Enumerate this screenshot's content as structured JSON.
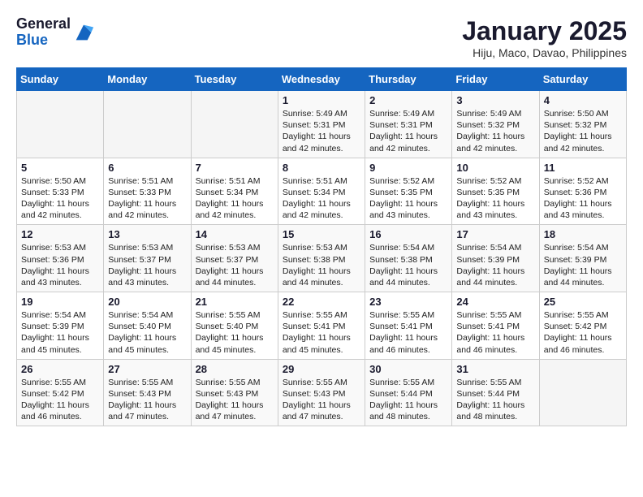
{
  "logo": {
    "general": "General",
    "blue": "Blue"
  },
  "title": "January 2025",
  "subtitle": "Hiju, Maco, Davao, Philippines",
  "days_header": [
    "Sunday",
    "Monday",
    "Tuesday",
    "Wednesday",
    "Thursday",
    "Friday",
    "Saturday"
  ],
  "weeks": [
    [
      {
        "day": "",
        "info": ""
      },
      {
        "day": "",
        "info": ""
      },
      {
        "day": "",
        "info": ""
      },
      {
        "day": "1",
        "info": "Sunrise: 5:49 AM\nSunset: 5:31 PM\nDaylight: 11 hours\nand 42 minutes."
      },
      {
        "day": "2",
        "info": "Sunrise: 5:49 AM\nSunset: 5:31 PM\nDaylight: 11 hours\nand 42 minutes."
      },
      {
        "day": "3",
        "info": "Sunrise: 5:49 AM\nSunset: 5:32 PM\nDaylight: 11 hours\nand 42 minutes."
      },
      {
        "day": "4",
        "info": "Sunrise: 5:50 AM\nSunset: 5:32 PM\nDaylight: 11 hours\nand 42 minutes."
      }
    ],
    [
      {
        "day": "5",
        "info": "Sunrise: 5:50 AM\nSunset: 5:33 PM\nDaylight: 11 hours\nand 42 minutes."
      },
      {
        "day": "6",
        "info": "Sunrise: 5:51 AM\nSunset: 5:33 PM\nDaylight: 11 hours\nand 42 minutes."
      },
      {
        "day": "7",
        "info": "Sunrise: 5:51 AM\nSunset: 5:34 PM\nDaylight: 11 hours\nand 42 minutes."
      },
      {
        "day": "8",
        "info": "Sunrise: 5:51 AM\nSunset: 5:34 PM\nDaylight: 11 hours\nand 42 minutes."
      },
      {
        "day": "9",
        "info": "Sunrise: 5:52 AM\nSunset: 5:35 PM\nDaylight: 11 hours\nand 43 minutes."
      },
      {
        "day": "10",
        "info": "Sunrise: 5:52 AM\nSunset: 5:35 PM\nDaylight: 11 hours\nand 43 minutes."
      },
      {
        "day": "11",
        "info": "Sunrise: 5:52 AM\nSunset: 5:36 PM\nDaylight: 11 hours\nand 43 minutes."
      }
    ],
    [
      {
        "day": "12",
        "info": "Sunrise: 5:53 AM\nSunset: 5:36 PM\nDaylight: 11 hours\nand 43 minutes."
      },
      {
        "day": "13",
        "info": "Sunrise: 5:53 AM\nSunset: 5:37 PM\nDaylight: 11 hours\nand 43 minutes."
      },
      {
        "day": "14",
        "info": "Sunrise: 5:53 AM\nSunset: 5:37 PM\nDaylight: 11 hours\nand 44 minutes."
      },
      {
        "day": "15",
        "info": "Sunrise: 5:53 AM\nSunset: 5:38 PM\nDaylight: 11 hours\nand 44 minutes."
      },
      {
        "day": "16",
        "info": "Sunrise: 5:54 AM\nSunset: 5:38 PM\nDaylight: 11 hours\nand 44 minutes."
      },
      {
        "day": "17",
        "info": "Sunrise: 5:54 AM\nSunset: 5:39 PM\nDaylight: 11 hours\nand 44 minutes."
      },
      {
        "day": "18",
        "info": "Sunrise: 5:54 AM\nSunset: 5:39 PM\nDaylight: 11 hours\nand 44 minutes."
      }
    ],
    [
      {
        "day": "19",
        "info": "Sunrise: 5:54 AM\nSunset: 5:39 PM\nDaylight: 11 hours\nand 45 minutes."
      },
      {
        "day": "20",
        "info": "Sunrise: 5:54 AM\nSunset: 5:40 PM\nDaylight: 11 hours\nand 45 minutes."
      },
      {
        "day": "21",
        "info": "Sunrise: 5:55 AM\nSunset: 5:40 PM\nDaylight: 11 hours\nand 45 minutes."
      },
      {
        "day": "22",
        "info": "Sunrise: 5:55 AM\nSunset: 5:41 PM\nDaylight: 11 hours\nand 45 minutes."
      },
      {
        "day": "23",
        "info": "Sunrise: 5:55 AM\nSunset: 5:41 PM\nDaylight: 11 hours\nand 46 minutes."
      },
      {
        "day": "24",
        "info": "Sunrise: 5:55 AM\nSunset: 5:41 PM\nDaylight: 11 hours\nand 46 minutes."
      },
      {
        "day": "25",
        "info": "Sunrise: 5:55 AM\nSunset: 5:42 PM\nDaylight: 11 hours\nand 46 minutes."
      }
    ],
    [
      {
        "day": "26",
        "info": "Sunrise: 5:55 AM\nSunset: 5:42 PM\nDaylight: 11 hours\nand 46 minutes."
      },
      {
        "day": "27",
        "info": "Sunrise: 5:55 AM\nSunset: 5:43 PM\nDaylight: 11 hours\nand 47 minutes."
      },
      {
        "day": "28",
        "info": "Sunrise: 5:55 AM\nSunset: 5:43 PM\nDaylight: 11 hours\nand 47 minutes."
      },
      {
        "day": "29",
        "info": "Sunrise: 5:55 AM\nSunset: 5:43 PM\nDaylight: 11 hours\nand 47 minutes."
      },
      {
        "day": "30",
        "info": "Sunrise: 5:55 AM\nSunset: 5:44 PM\nDaylight: 11 hours\nand 48 minutes."
      },
      {
        "day": "31",
        "info": "Sunrise: 5:55 AM\nSunset: 5:44 PM\nDaylight: 11 hours\nand 48 minutes."
      },
      {
        "day": "",
        "info": ""
      }
    ]
  ]
}
